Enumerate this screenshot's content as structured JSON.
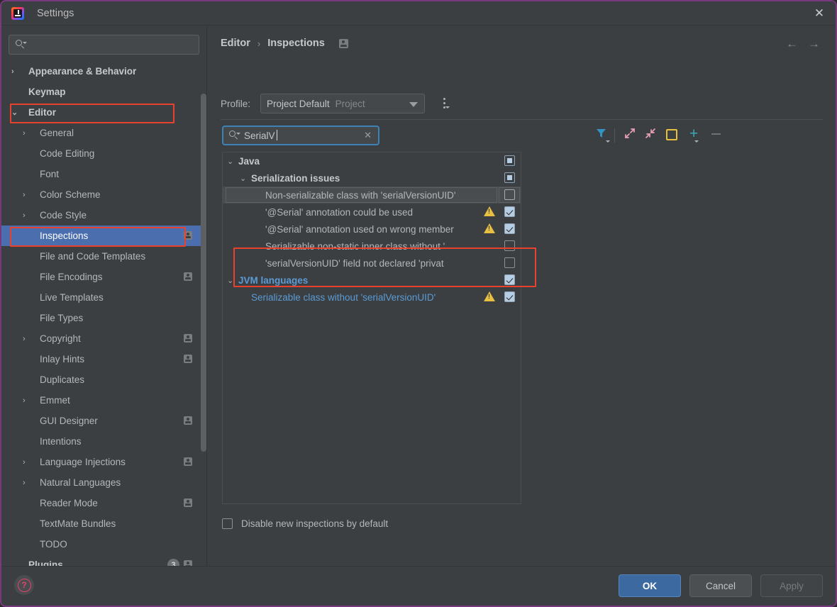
{
  "window": {
    "title": "Settings",
    "app_icon": "intellij-idea-icon",
    "close_icon": "close-icon"
  },
  "sidebar": {
    "search": {
      "value": "",
      "placeholder": "",
      "icon": "search-icon"
    },
    "items": [
      {
        "label": "Appearance & Behavior",
        "arrow": "›",
        "bold": true,
        "indent": 0,
        "badge": false
      },
      {
        "label": "Keymap",
        "arrow": "",
        "bold": true,
        "indent": 0,
        "badge": false
      },
      {
        "label": "Editor",
        "arrow": "⌄",
        "bold": true,
        "indent": 0,
        "badge": false
      },
      {
        "label": "General",
        "arrow": "›",
        "bold": false,
        "indent": 1,
        "badge": false
      },
      {
        "label": "Code Editing",
        "arrow": "",
        "bold": false,
        "indent": 1,
        "badge": false
      },
      {
        "label": "Font",
        "arrow": "",
        "bold": false,
        "indent": 1,
        "badge": false
      },
      {
        "label": "Color Scheme",
        "arrow": "›",
        "bold": false,
        "indent": 1,
        "badge": false
      },
      {
        "label": "Code Style",
        "arrow": "›",
        "bold": false,
        "indent": 1,
        "badge": false
      },
      {
        "label": "Inspections",
        "arrow": "",
        "bold": false,
        "indent": 1,
        "badge": true,
        "selected": true
      },
      {
        "label": "File and Code Templates",
        "arrow": "",
        "bold": false,
        "indent": 1,
        "badge": false
      },
      {
        "label": "File Encodings",
        "arrow": "",
        "bold": false,
        "indent": 1,
        "badge": true
      },
      {
        "label": "Live Templates",
        "arrow": "",
        "bold": false,
        "indent": 1,
        "badge": false
      },
      {
        "label": "File Types",
        "arrow": "",
        "bold": false,
        "indent": 1,
        "badge": false
      },
      {
        "label": "Copyright",
        "arrow": "›",
        "bold": false,
        "indent": 1,
        "badge": true
      },
      {
        "label": "Inlay Hints",
        "arrow": "",
        "bold": false,
        "indent": 1,
        "badge": true
      },
      {
        "label": "Duplicates",
        "arrow": "",
        "bold": false,
        "indent": 1,
        "badge": false
      },
      {
        "label": "Emmet",
        "arrow": "›",
        "bold": false,
        "indent": 1,
        "badge": false
      },
      {
        "label": "GUI Designer",
        "arrow": "",
        "bold": false,
        "indent": 1,
        "badge": true
      },
      {
        "label": "Intentions",
        "arrow": "",
        "bold": false,
        "indent": 1,
        "badge": false
      },
      {
        "label": "Language Injections",
        "arrow": "›",
        "bold": false,
        "indent": 1,
        "badge": true
      },
      {
        "label": "Natural Languages",
        "arrow": "›",
        "bold": false,
        "indent": 1,
        "badge": false
      },
      {
        "label": "Reader Mode",
        "arrow": "",
        "bold": false,
        "indent": 1,
        "badge": true
      },
      {
        "label": "TextMate Bundles",
        "arrow": "",
        "bold": false,
        "indent": 1,
        "badge": false
      },
      {
        "label": "TODO",
        "arrow": "",
        "bold": false,
        "indent": 1,
        "badge": false
      },
      {
        "label": "Plugins",
        "arrow": "",
        "bold": true,
        "indent": 0,
        "badge": true,
        "count": "3"
      }
    ]
  },
  "main": {
    "breadcrumb": {
      "parent": "Editor",
      "separator": "›",
      "current": "Inspections",
      "badge_icon": "project-scope-icon"
    },
    "nav": {
      "back_icon": "arrow-left-icon",
      "forward_icon": "arrow-right-icon"
    },
    "profile": {
      "label": "Profile:",
      "value": "Project Default",
      "scope": "Project",
      "dropdown_icon": "chevron-down-icon",
      "menu_icon": "kebab-menu-icon"
    },
    "inspection_search": {
      "value": "SerialV",
      "search_icon": "search-icon",
      "clear_icon": "clear-icon"
    },
    "toolbar": [
      {
        "name": "filter-icon",
        "label": "Filter"
      },
      {
        "name": "expand-all-icon",
        "label": "Expand All"
      },
      {
        "name": "collapse-all-icon",
        "label": "Collapse All"
      },
      {
        "name": "reset-to-defaults-icon",
        "label": "Reset"
      },
      {
        "name": "add-icon",
        "label": "Add"
      },
      {
        "name": "remove-icon",
        "label": "Remove"
      }
    ],
    "tree": [
      {
        "label": "Java",
        "level": 0,
        "arrow": "⌄",
        "style": "group",
        "checkbox": "partial",
        "warning": false
      },
      {
        "label": "Serialization issues",
        "level": 1,
        "arrow": "⌄",
        "style": "group",
        "checkbox": "partial",
        "warning": false
      },
      {
        "label": "Non-serializable class with 'serialVersionUID'",
        "level": 2,
        "arrow": "",
        "style": "item",
        "checkbox": "hover-unchecked",
        "warning": false,
        "hovered": true
      },
      {
        "label": "'@Serial' annotation could be used",
        "level": 2,
        "arrow": "",
        "style": "item",
        "checkbox": "checked",
        "warning": true
      },
      {
        "label": "'@Serial' annotation used on wrong member",
        "level": 2,
        "arrow": "",
        "style": "item",
        "checkbox": "checked",
        "warning": true
      },
      {
        "label": "Serializable non-static inner class without '",
        "level": 2,
        "arrow": "",
        "style": "item",
        "checkbox": "unchecked",
        "warning": false
      },
      {
        "label": "'serialVersionUID' field not declared 'privat",
        "level": 2,
        "arrow": "",
        "style": "item",
        "checkbox": "unchecked",
        "warning": false
      },
      {
        "label": "JVM languages",
        "level": 0,
        "arrow": "⌄",
        "style": "jvm",
        "checkbox": "checked",
        "warning": false
      },
      {
        "label": "Serializable class without 'serialVersionUID'",
        "level": 1,
        "arrow": "",
        "style": "jvmchild",
        "checkbox": "checked",
        "warning": true
      }
    ],
    "disable_new": {
      "label": "Disable new inspections by default",
      "checked": false
    }
  },
  "footer": {
    "help_icon": "help-question-icon",
    "buttons": [
      {
        "label": "OK",
        "state": "primary"
      },
      {
        "label": "Cancel",
        "state": "normal"
      },
      {
        "label": "Apply",
        "state": "disabled"
      }
    ]
  },
  "colors": {
    "accent_blue": "#4b6eaf",
    "highlight_red": "#e8422f",
    "warning_yellow": "#e8bf3e",
    "link_blue": "#5b9bd5",
    "window_border": "#78397f"
  }
}
